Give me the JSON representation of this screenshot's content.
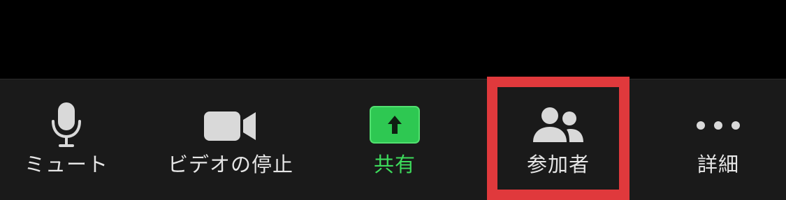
{
  "toolbar": {
    "mute": {
      "label": "ミュート",
      "icon": "microphone-icon"
    },
    "stop_video": {
      "label": "ビデオの停止",
      "icon": "video-camera-icon"
    },
    "share": {
      "label": "共有",
      "icon": "share-arrow-up-icon",
      "accent": "#3ddc5c"
    },
    "participants": {
      "label": "参加者",
      "icon": "participants-icon",
      "highlighted": true
    },
    "more": {
      "label": "詳細",
      "icon": "more-dots-icon"
    }
  },
  "colors": {
    "background": "#000000",
    "toolbar": "#1a1a1a",
    "icon": "#d9d9d9",
    "text": "#e6e6e6",
    "share_green": "#3ddc5c",
    "highlight": "#e0393c"
  }
}
